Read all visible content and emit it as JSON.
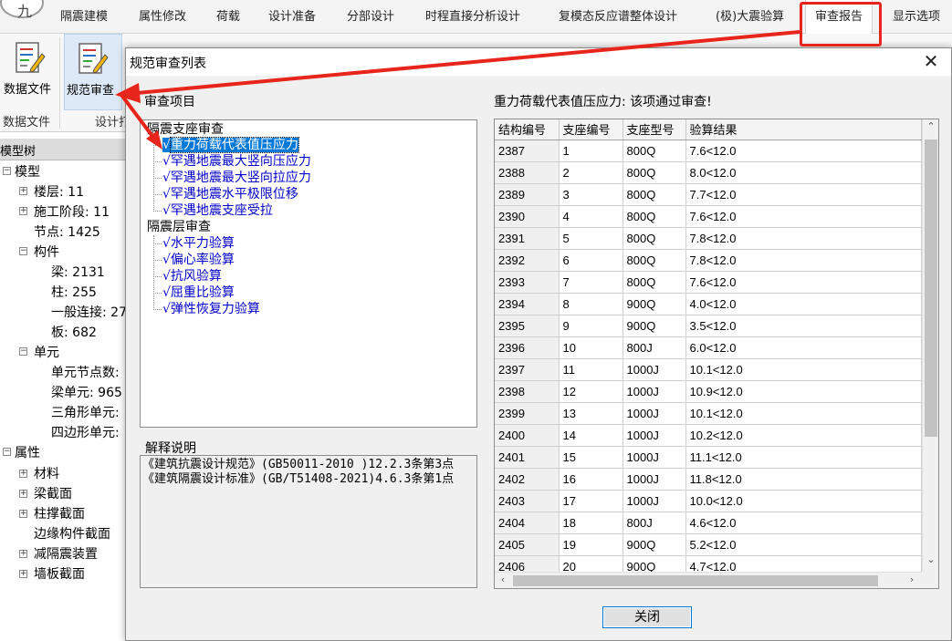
{
  "tabs": [
    "隔震建模",
    "属性修改",
    "荷载",
    "设计准备",
    "分部设计",
    "时程直接分析设计",
    "复模态反应谱整体设计",
    "(极)大震验算",
    "审查报告",
    "显示选项"
  ],
  "active_tab": "审查报告",
  "ribbon": {
    "data_file_label": "数据文件",
    "code_review_label": "规范审查",
    "group_data_file": "数据文件",
    "group_design": "设计打"
  },
  "model_tree": {
    "header": "模型树",
    "items": {
      "model": "模型",
      "floors": "楼层: 11",
      "stages": "施工阶段: 11",
      "nodes": "节点:   1425",
      "members": "构件",
      "beams": "梁: 2131",
      "columns": "柱: 255",
      "general_links": "一般连接: 27",
      "slabs": "板: 682",
      "elements": "单元",
      "elem_nodes": "单元节点数:",
      "beam_elems": "梁单元: 965",
      "tri_elems": "三角形单元:",
      "quad_elems": "四边形单元:",
      "properties": "属性",
      "materials": "材料",
      "beam_sections": "梁截面",
      "column_sections": "柱撑截面",
      "edge_sections": "边缘构件截面",
      "isolation_devices": "减隔震装置",
      "wall_sections": "墙板截面"
    }
  },
  "dialog": {
    "title": "规范审查列表",
    "close_glyph": "✕",
    "review_items_label": "审查项目",
    "review_tree": {
      "cat1": "隔震支座审查",
      "cat1_items": [
        "重力荷载代表值压应力",
        "罕遇地震最大竖向压应力",
        "罕遇地震最大竖向拉应力",
        "罕遇地震水平极限位移",
        "罕遇地震支座受拉"
      ],
      "cat2": "隔震层审查",
      "cat2_items": [
        "水平力验算",
        "偏心率验算",
        "抗风验算",
        "屈重比验算",
        "弹性恢复力验算"
      ],
      "check_glyph": "√"
    },
    "explain_label": "解释说明",
    "explain_lines": [
      "《建筑抗震设计规范》(GB50011-2010 )12.2.3条第3点",
      "《建筑隔震设计标准》(GB/T51408-2021)4.6.3条第1点"
    ],
    "result_header": "重力荷载代表值压应力: 该项通过审查!",
    "columns": [
      "结构编号",
      "支座编号",
      "支座型号",
      "验算结果"
    ],
    "rows": [
      [
        "2387",
        "1",
        "800Q",
        "7.6<12.0"
      ],
      [
        "2388",
        "2",
        "800Q",
        "8.0<12.0"
      ],
      [
        "2389",
        "3",
        "800Q",
        "7.7<12.0"
      ],
      [
        "2390",
        "4",
        "800Q",
        "7.6<12.0"
      ],
      [
        "2391",
        "5",
        "800Q",
        "7.8<12.0"
      ],
      [
        "2392",
        "6",
        "800Q",
        "7.8<12.0"
      ],
      [
        "2393",
        "7",
        "800Q",
        "7.6<12.0"
      ],
      [
        "2394",
        "8",
        "900Q",
        "4.0<12.0"
      ],
      [
        "2395",
        "9",
        "900Q",
        "3.5<12.0"
      ],
      [
        "2396",
        "10",
        "800J",
        "6.0<12.0"
      ],
      [
        "2397",
        "11",
        "1000J",
        "10.1<12.0"
      ],
      [
        "2398",
        "12",
        "1000J",
        "10.9<12.0"
      ],
      [
        "2399",
        "13",
        "1000J",
        "10.1<12.0"
      ],
      [
        "2400",
        "14",
        "1000J",
        "10.2<12.0"
      ],
      [
        "2401",
        "15",
        "1000J",
        "11.1<12.0"
      ],
      [
        "2402",
        "16",
        "1000J",
        "11.8<12.0"
      ],
      [
        "2403",
        "17",
        "1000J",
        "10.0<12.0"
      ],
      [
        "2404",
        "18",
        "800J",
        "4.6<12.0"
      ],
      [
        "2405",
        "19",
        "900Q",
        "5.2<12.0"
      ],
      [
        "2406",
        "20",
        "900Q",
        "4.7<12.0"
      ]
    ],
    "close_button": "关闭"
  },
  "colors": {
    "annotation_red": "#e8251c",
    "selection_blue": "#0078d7",
    "link_blue": "#0000cc"
  }
}
